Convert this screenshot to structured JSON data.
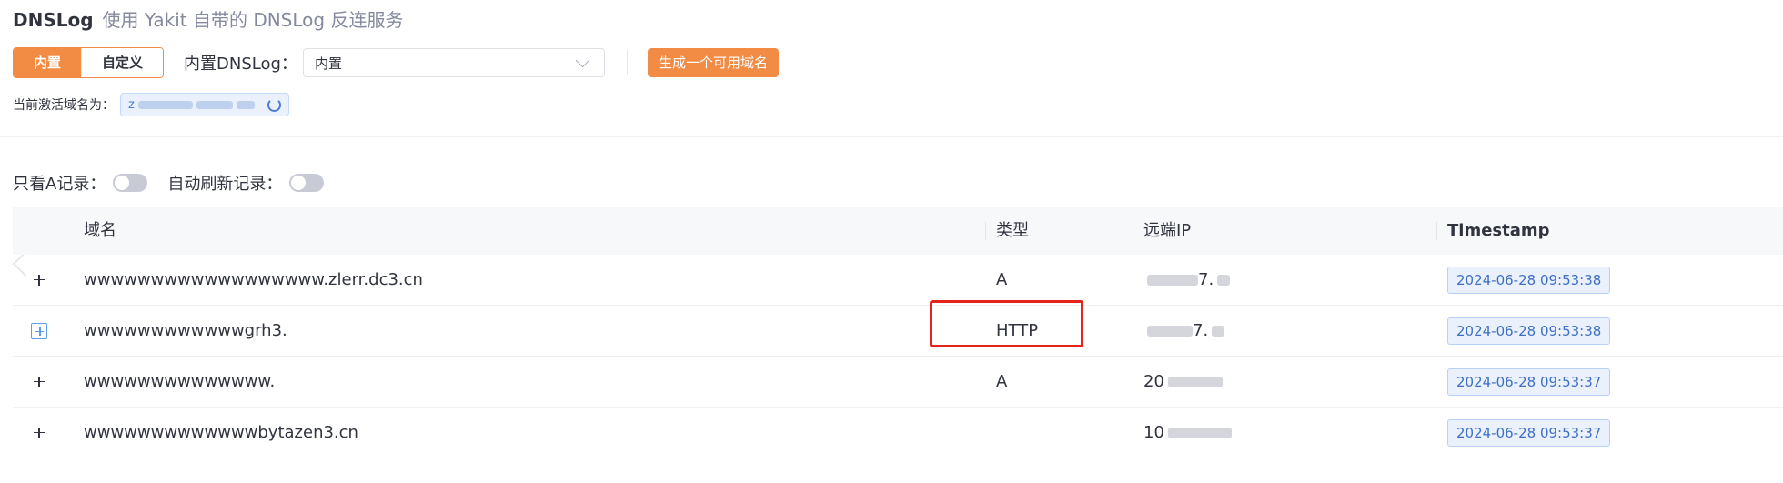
{
  "header": {
    "title": "DNSLog",
    "subtitle": "使用 Yakit 自带的 DNSLog 反连服务"
  },
  "mode": {
    "builtin_label": "内置",
    "custom_label": "自定义",
    "active": "内置"
  },
  "builtin_dnslog": {
    "label": "内置DNSLog：",
    "selected": "内置"
  },
  "generate_button": "生成一个可用域名",
  "active_domain": {
    "label": "当前激活域名为：",
    "value": "z"
  },
  "filters": {
    "only_a_label": "只看A记录：",
    "auto_refresh_label": "自动刷新记录："
  },
  "table": {
    "columns": [
      "域名",
      "类型",
      "远端IP",
      "Timestamp"
    ],
    "rows": [
      {
        "domain": "wwwwwwwwwwwwwwwwww.zlerr.dc3.cn",
        "type": "A",
        "ip": "7.",
        "timestamp": "2024-06-28 09:53:38"
      },
      {
        "domain": "wwwwwwwwwwwwgrh3.",
        "type": "HTTP",
        "ip": "7.",
        "timestamp": "2024-06-28 09:53:38"
      },
      {
        "domain": "wwwwwwwwwwwwww.",
        "type": "A",
        "ip": "20",
        "timestamp": "2024-06-28 09:53:37"
      },
      {
        "domain": "wwwwwwwwwwwwwbytazen3.cn",
        "type": "",
        "ip": "10",
        "timestamp": "2024-06-28 09:53:37"
      }
    ]
  },
  "colors": {
    "accent": "#f28b44",
    "tag_blue": "#3f6fc4",
    "highlight": "#e5241b"
  }
}
